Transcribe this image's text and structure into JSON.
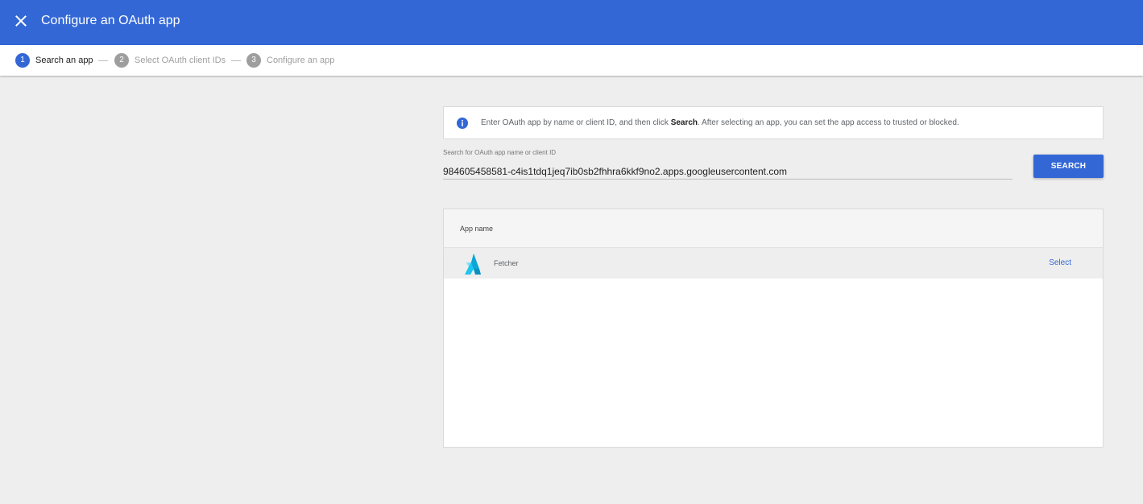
{
  "header": {
    "title": "Configure an OAuth app",
    "background_color": "#3367d6"
  },
  "stepper": {
    "steps": [
      {
        "number": "1",
        "label": "Search an app",
        "active": true
      },
      {
        "number": "2",
        "label": "Select OAuth client IDs",
        "active": false
      },
      {
        "number": "3",
        "label": "Configure an app",
        "active": false
      }
    ]
  },
  "info": {
    "text_before": "Enter OAuth app by name or client ID, and then click ",
    "bold": "Search",
    "text_after": ". After selecting an app, you can set the app access to trusted or blocked."
  },
  "search": {
    "label": "Search for OAuth app name or client ID",
    "value": "984605458581-c4is1tdq1jeq7ib0sb2fhhra6kkf9no2.apps.googleusercontent.com",
    "button_label": "SEARCH"
  },
  "table": {
    "column_header": "App name",
    "rows": [
      {
        "app_name": "Fetcher",
        "action_label": "Select",
        "logo_icon": "fetcher-logo-icon"
      }
    ]
  },
  "colors": {
    "accent": "#3367d6",
    "logo": "#1ec5ef"
  }
}
